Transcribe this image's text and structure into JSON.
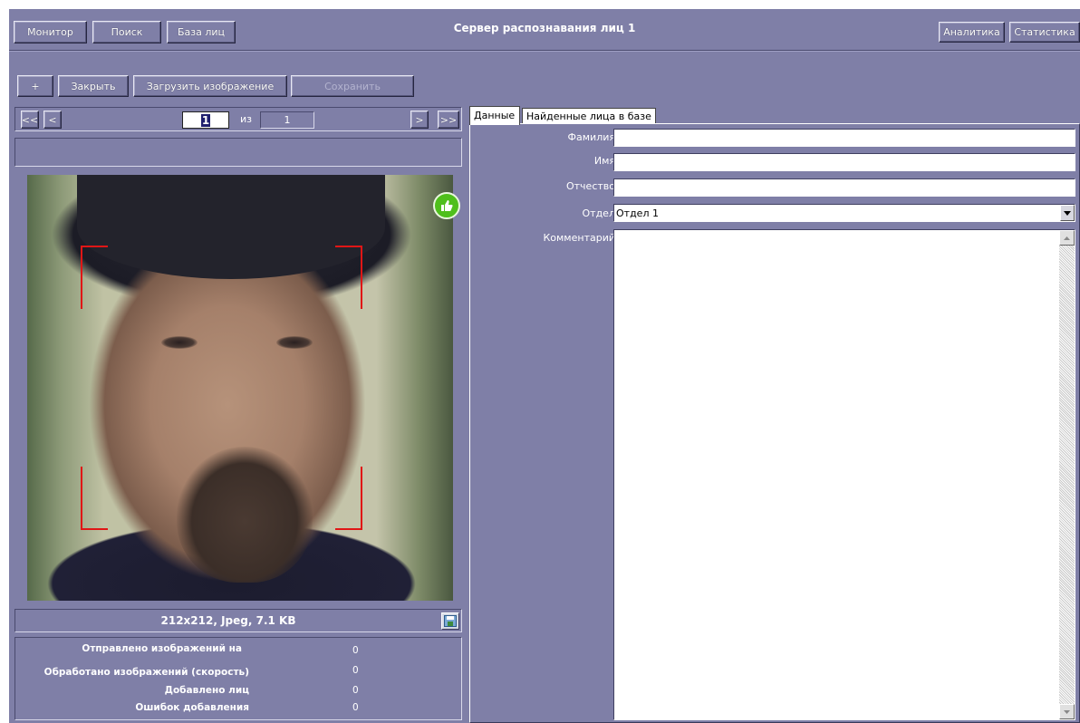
{
  "header": {
    "nav": [
      "Монитор",
      "Поиск",
      "База лиц"
    ],
    "title": "Сервер распознавания лиц 1",
    "right": [
      "Аналитика",
      "Статистика"
    ]
  },
  "toolbar": {
    "add": "+",
    "close": "Закрыть",
    "load": "Загрузить изображение",
    "save": "Сохранить"
  },
  "pager": {
    "first": "<<",
    "prev": "<",
    "current": "1",
    "of": "из",
    "total": "1",
    "next": ">",
    "last": ">>"
  },
  "image": {
    "info": "212x212, Jpeg, 7.1 KB"
  },
  "stats": [
    {
      "label": "Отправлено изображений на",
      "value": "0"
    },
    {
      "label": "Обработано изображений (скорость)",
      "value": "0"
    },
    {
      "label": "Добавлено лиц",
      "value": "0"
    },
    {
      "label": "Ошибок добавления",
      "value": "0"
    }
  ],
  "tabs": [
    "Данные",
    "Найденные лица в базе"
  ],
  "form": {
    "surname_label": "Фамилия",
    "surname": "",
    "name_label": "Имя",
    "name": "",
    "patronymic_label": "Отчество",
    "patronymic": "",
    "dept_label": "Отдел",
    "dept": "Отдел 1",
    "comment_label": "Комментарий",
    "comment": ""
  },
  "colors": {
    "background": "#7f7fa7",
    "face_box": "#e01616",
    "like_badge": "#4fbf1c"
  }
}
